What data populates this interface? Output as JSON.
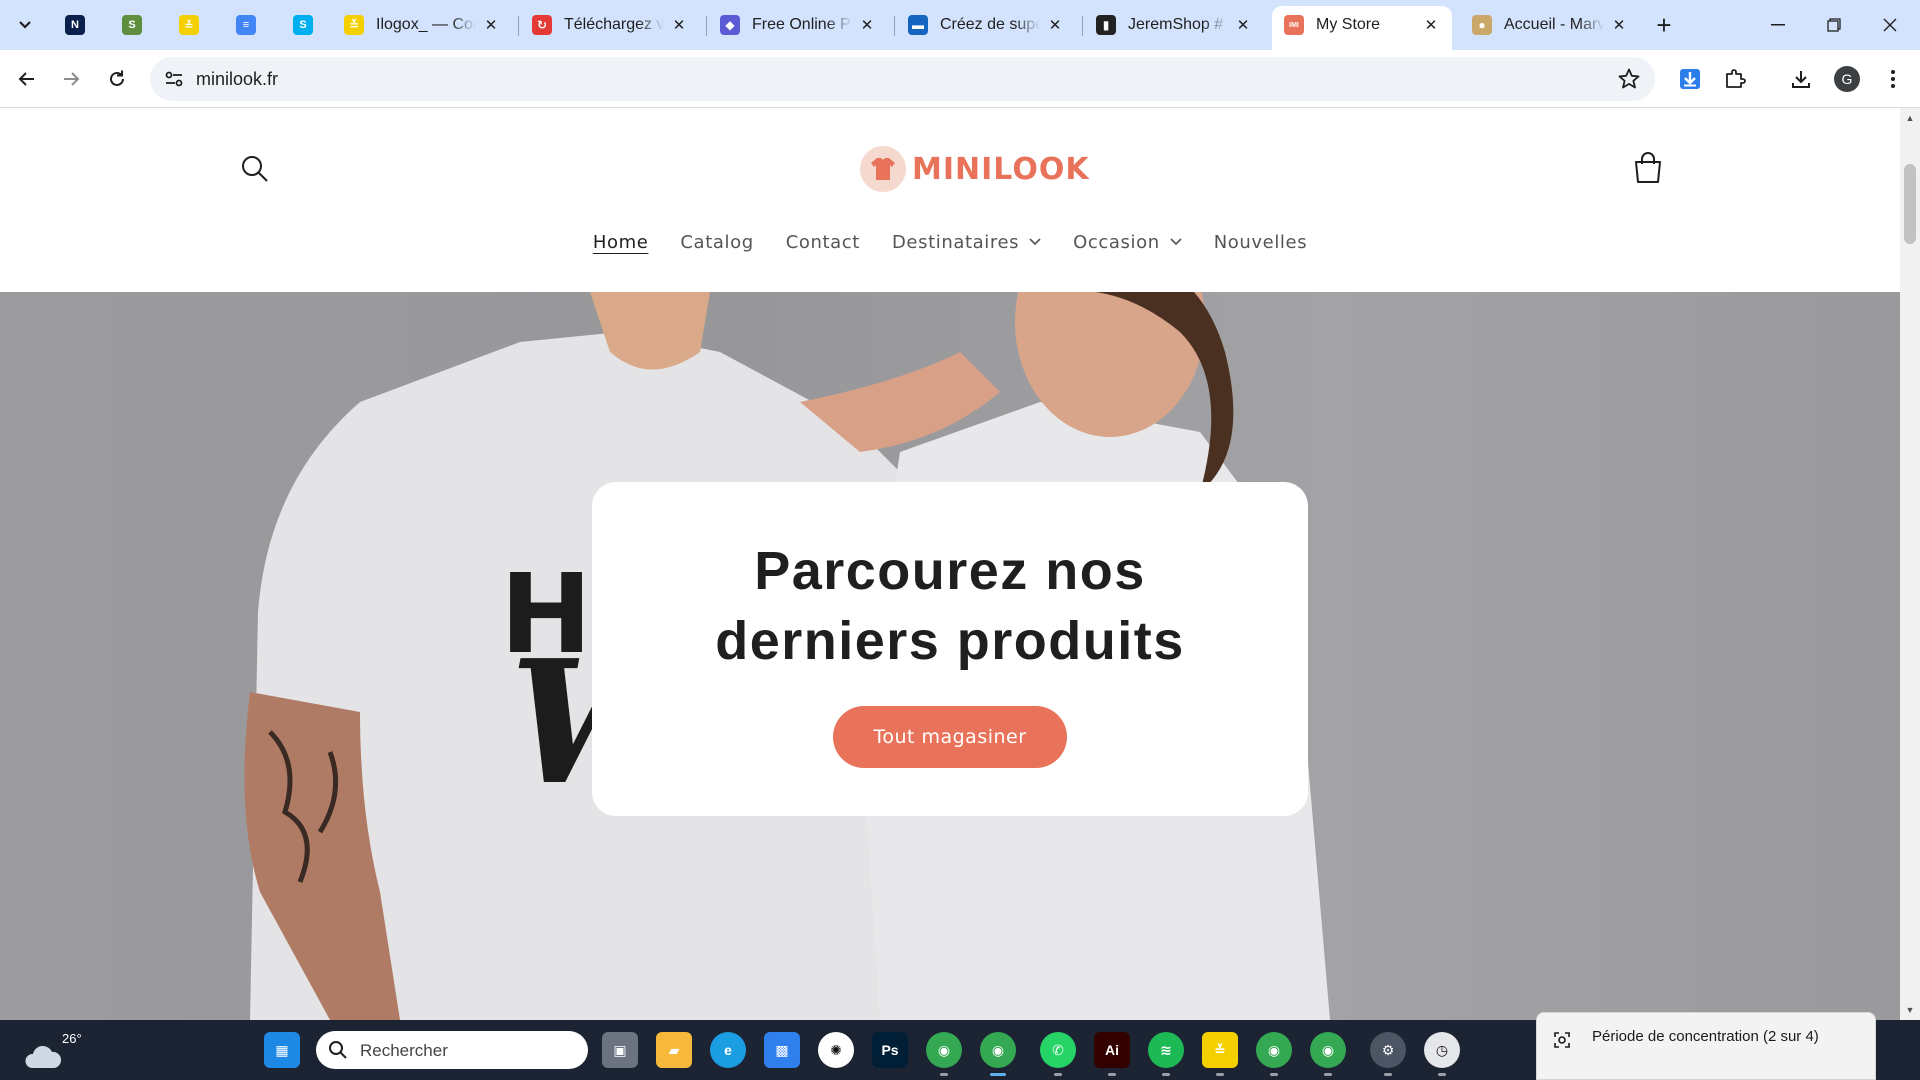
{
  "browser": {
    "pinned_tabs": [
      {
        "name": "pinned-tab-n",
        "glyph": "N",
        "color": "#0b1f4d"
      },
      {
        "name": "pinned-tab-shopify",
        "glyph": "S",
        "color": "#5e8e3e"
      },
      {
        "name": "pinned-tab-yellow",
        "glyph": "≚",
        "color": "#f5d000"
      },
      {
        "name": "pinned-tab-docs",
        "glyph": "≡",
        "color": "#4285f4"
      },
      {
        "name": "pinned-tab-skype",
        "glyph": "S",
        "color": "#00aff0"
      }
    ],
    "tabs": [
      {
        "title": "Ilogox_ — Com",
        "favicon": "≚",
        "favicon_color": "#f5d000"
      },
      {
        "title": "Téléchargez vo",
        "favicon": "↻",
        "favicon_color": "#e53935"
      },
      {
        "title": "Free Online Pro",
        "favicon": "◆",
        "favicon_color": "#5b5bd6"
      },
      {
        "title": "Créez de super",
        "favicon": "▬",
        "favicon_color": "#1565c0"
      },
      {
        "title": "JeremShop # S",
        "favicon": "▮",
        "favicon_color": "#222222"
      },
      {
        "title": "My Store",
        "favicon": "IMI",
        "favicon_color": "#e8735a",
        "active": true
      },
      {
        "title": "Accueil - Marv",
        "favicon": "●",
        "favicon_color": "#c9a86a"
      }
    ],
    "url": "minilook.fr",
    "profile_initial": "G"
  },
  "site": {
    "logo_text": "MINILOOK",
    "nav": [
      {
        "label": "Home",
        "current": true,
        "dropdown": false
      },
      {
        "label": "Catalog",
        "current": false,
        "dropdown": false
      },
      {
        "label": "Contact",
        "current": false,
        "dropdown": false
      },
      {
        "label": "Destinataires",
        "current": false,
        "dropdown": true
      },
      {
        "label": "Occasion",
        "current": false,
        "dropdown": true
      },
      {
        "label": "Nouvelles",
        "current": false,
        "dropdown": false
      }
    ],
    "hero": {
      "heading_line1": "Parcourez nos",
      "heading_line2": "derniers produits",
      "button_label": "Tout magasiner"
    },
    "accent_color": "#e8735a"
  },
  "taskbar": {
    "weather_temp": "26°",
    "search_placeholder": "Rechercher",
    "apps": [
      {
        "name": "start-icon",
        "glyph": "▦",
        "color": "#1e88e5"
      },
      {
        "name": "task-view-icon",
        "glyph": "▣",
        "color": "#6b7280"
      },
      {
        "name": "file-explorer-icon",
        "glyph": "▰",
        "color": "#f6b93b"
      },
      {
        "name": "edge-icon",
        "glyph": "e",
        "color": "#1b9de2"
      },
      {
        "name": "store-icon",
        "glyph": "▩",
        "color": "#2f80ed"
      },
      {
        "name": "chatgpt-icon",
        "glyph": "✺",
        "color": "#ffffff"
      },
      {
        "name": "photoshop-icon",
        "glyph": "Ps",
        "color": "#001e36"
      },
      {
        "name": "chrome-icon",
        "glyph": "◉",
        "color": "#34a853"
      },
      {
        "name": "chrome-profile-icon",
        "glyph": "◉",
        "color": "#34a853"
      },
      {
        "name": "whatsapp-icon",
        "glyph": "✆",
        "color": "#25d366"
      },
      {
        "name": "illustrator-icon",
        "glyph": "Ai",
        "color": "#330000"
      },
      {
        "name": "spotify-icon",
        "glyph": "≋",
        "color": "#1db954"
      },
      {
        "name": "yellow-app-icon",
        "glyph": "≚",
        "color": "#f5d000"
      },
      {
        "name": "chrome-profile-2-icon",
        "glyph": "◉",
        "color": "#34a853"
      },
      {
        "name": "chrome-profile-3-icon",
        "glyph": "◉",
        "color": "#34a853"
      },
      {
        "name": "settings-icon",
        "glyph": "⚙",
        "color": "#4b5563"
      },
      {
        "name": "clock-app-icon",
        "glyph": "◷",
        "color": "#e5e7eb"
      }
    ],
    "notification": "Période de concentration (2 sur 4)"
  }
}
